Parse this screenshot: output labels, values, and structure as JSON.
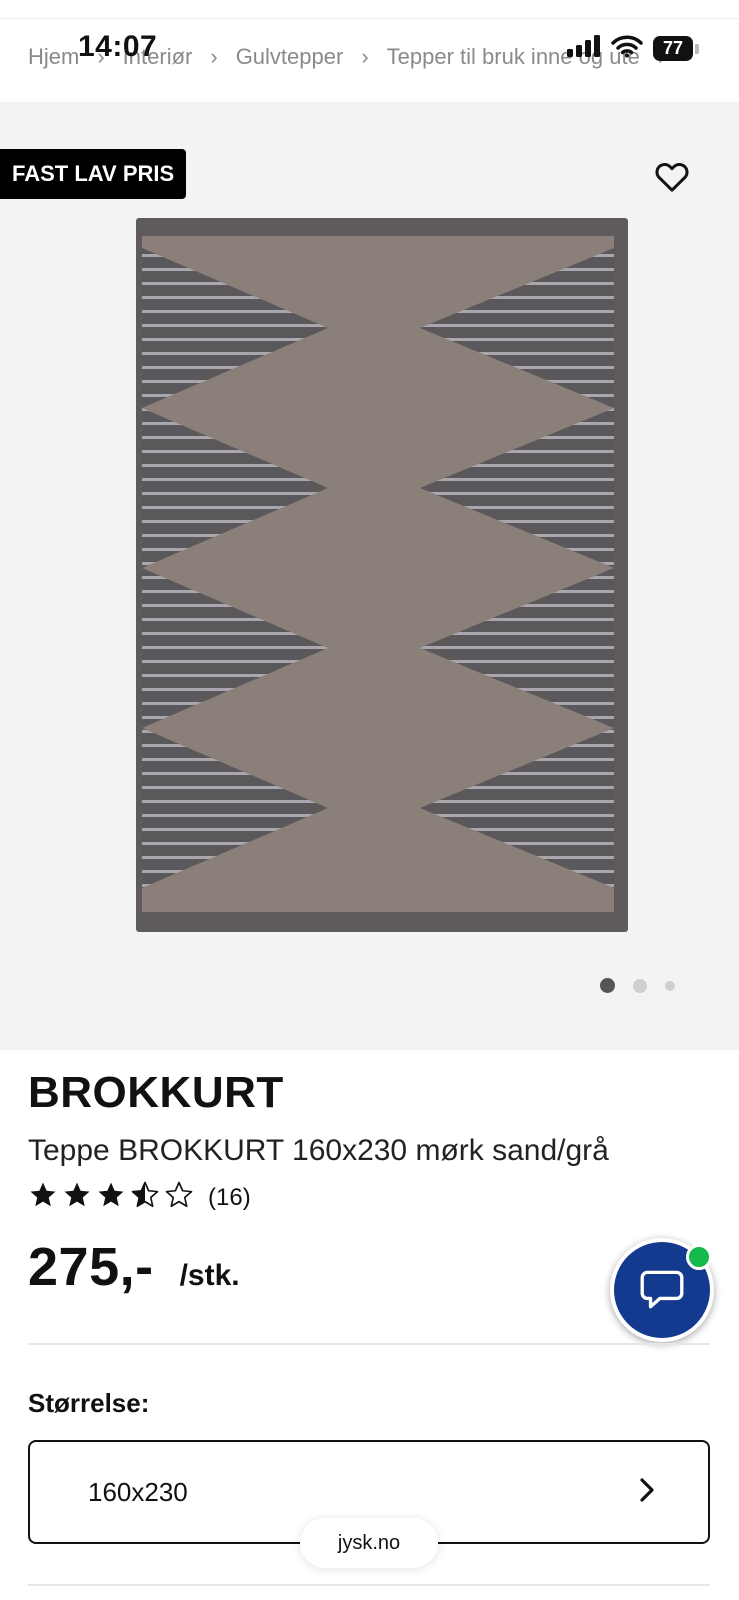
{
  "status_bar": {
    "time": "14:07",
    "battery_level": "77"
  },
  "breadcrumb": [
    {
      "label": "Hjem"
    },
    {
      "label": "Interiør"
    },
    {
      "label": "Gulvtepper"
    },
    {
      "label": "Tepper til bruk inne og ute"
    }
  ],
  "gallery": {
    "badge": "FAST LAV PRIS",
    "favorite_icon": "heart-outline-icon",
    "image_count": 3,
    "active_index": 0
  },
  "product": {
    "brand": "BROKKURT",
    "name": "Teppe BROKKURT 160x230 mørk sand/grå",
    "rating": 3.5,
    "rating_max": 5,
    "review_count": "(16)",
    "price": "275,-",
    "unit": "/stk."
  },
  "size_selector": {
    "label": "Størrelse:",
    "value": "160x230",
    "icon": "chevron-right-icon"
  },
  "chat": {
    "icon": "chat-bubble-icon",
    "online": true,
    "online_color": "#13b94a"
  },
  "browser": {
    "url": "jysk.no"
  },
  "colors": {
    "chat_button": "#143a8f",
    "badge_bg": "#000000",
    "gallery_bg": "#f3f3f3",
    "rug_light": "#8a7f79",
    "rug_dark": "#5b585b"
  }
}
